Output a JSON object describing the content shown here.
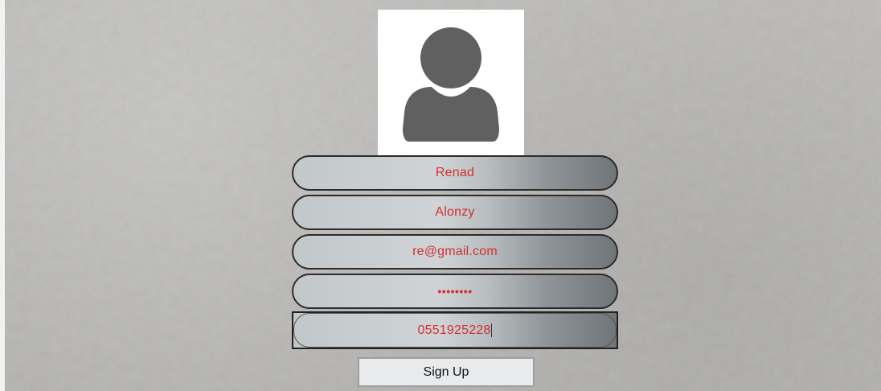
{
  "form": {
    "avatar_icon": "user-silhouette-icon",
    "fields": [
      {
        "name": "first-name",
        "value": "Renad"
      },
      {
        "name": "last-name",
        "value": "Alonzy"
      },
      {
        "name": "email",
        "value": "re@gmail.com"
      },
      {
        "name": "password",
        "value": "••••••••"
      },
      {
        "name": "phone",
        "value": "0551925228"
      }
    ],
    "signup_label": "Sign Up"
  },
  "colors": {
    "field_text": "#d32f2f",
    "avatar": "#606060",
    "background": "#b9b8b5"
  }
}
